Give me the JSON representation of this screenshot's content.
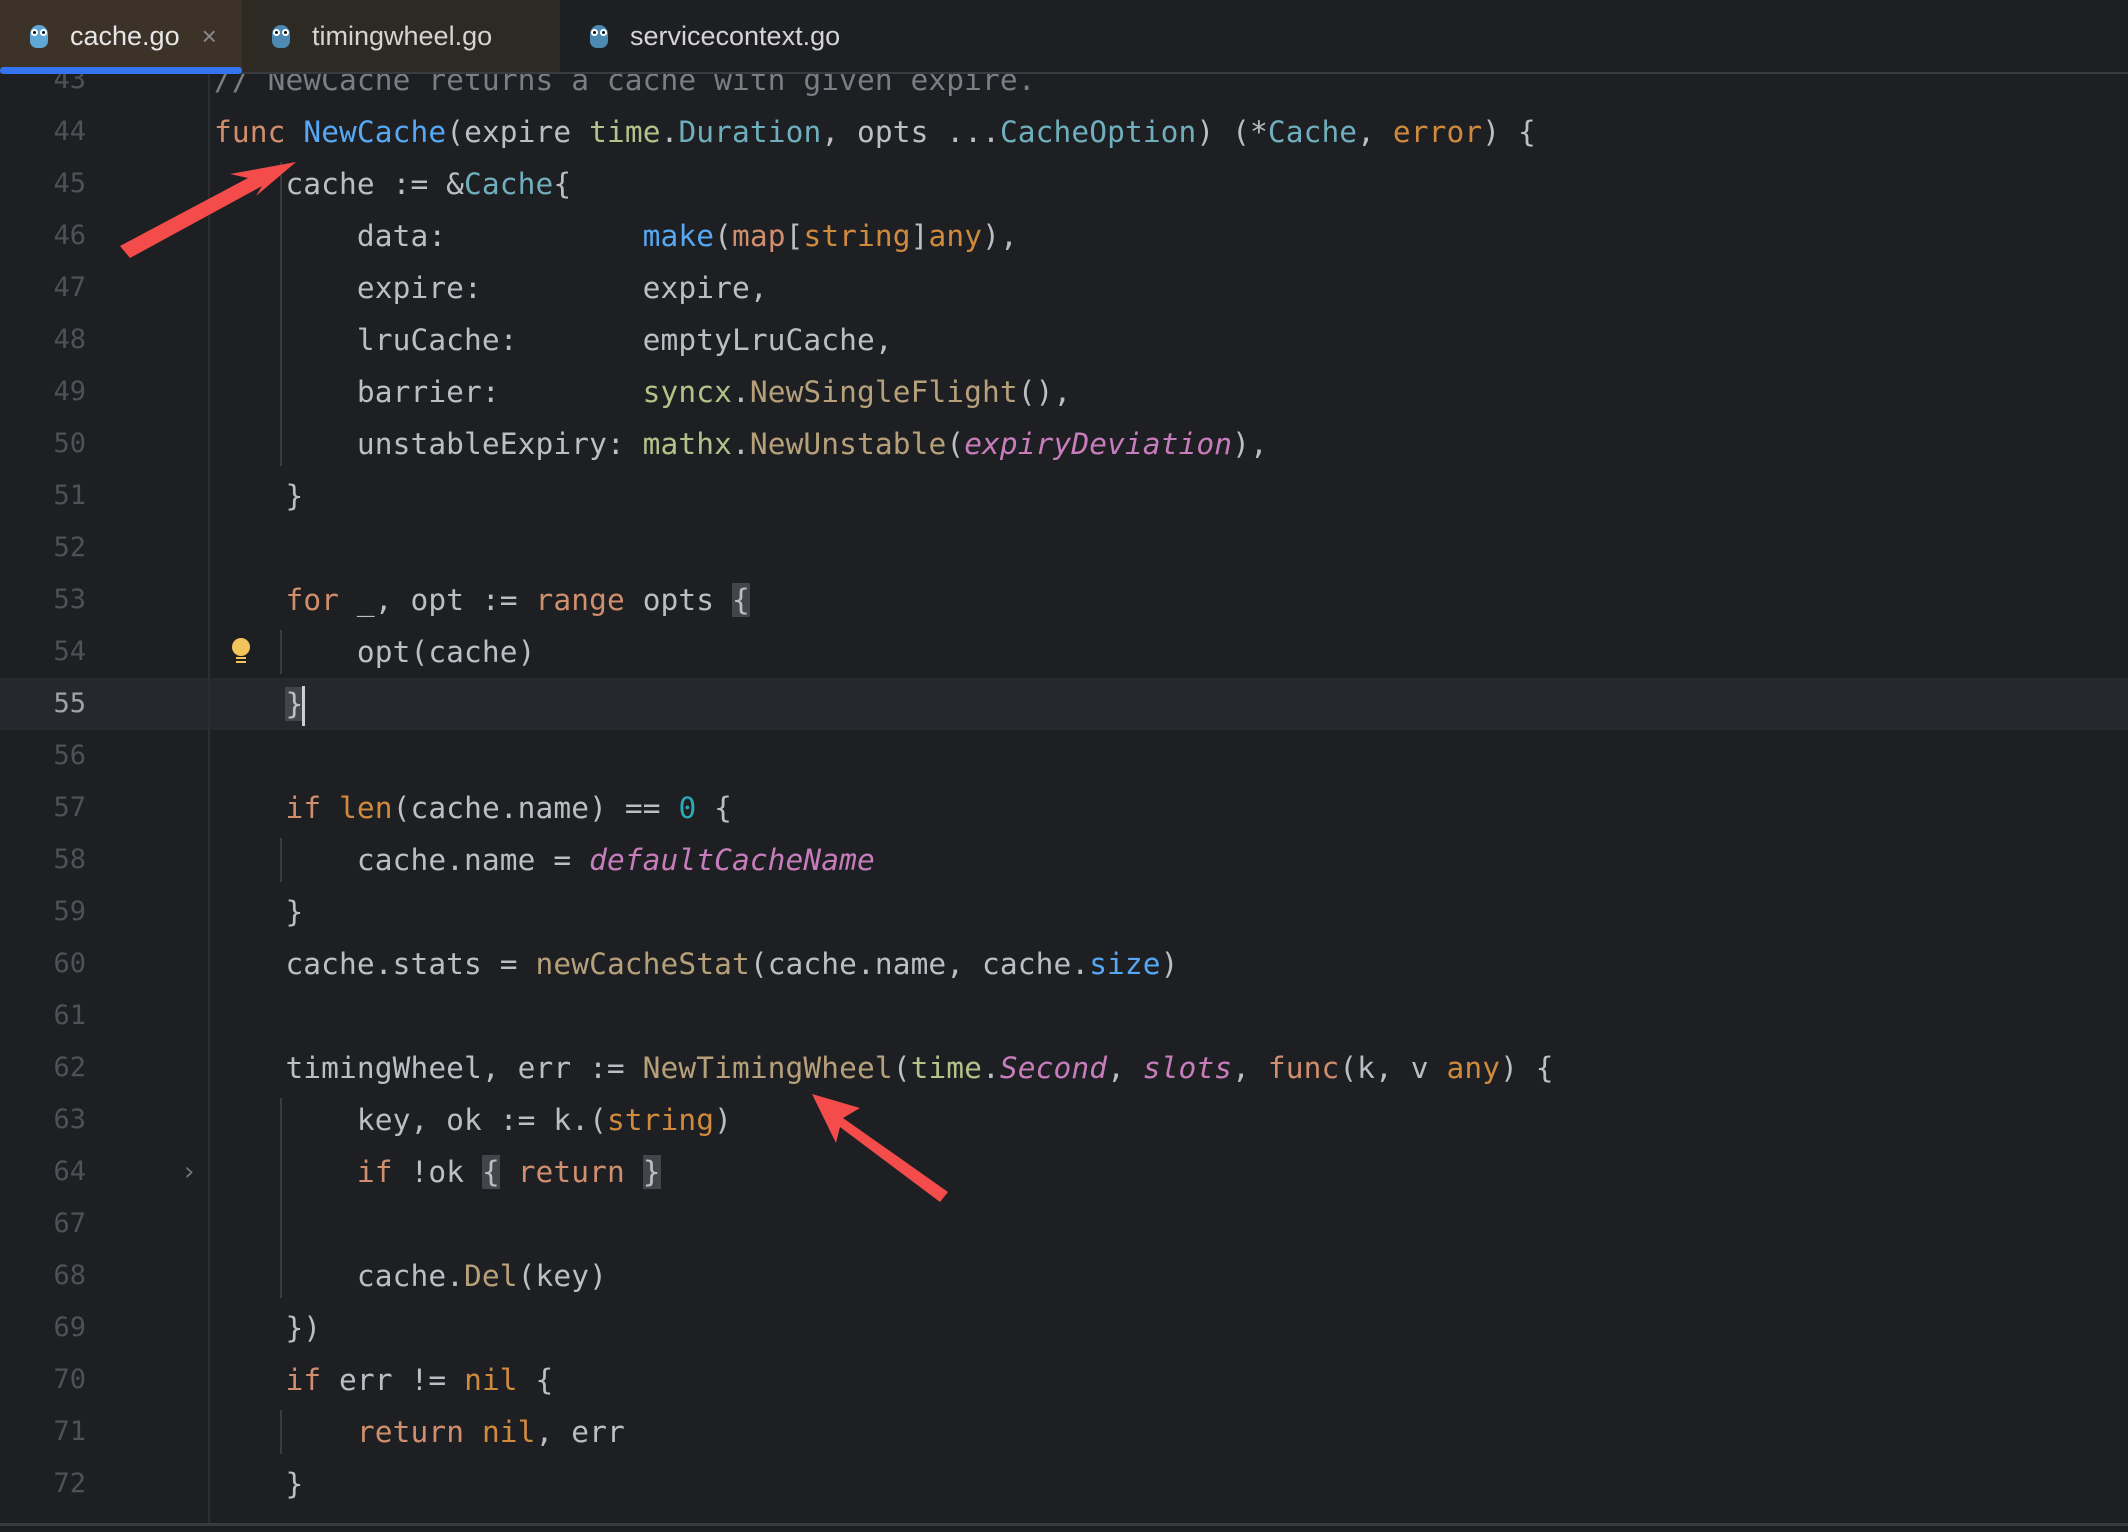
{
  "tabs": [
    {
      "label": "cache.go",
      "icon": "gopher-icon",
      "active": true,
      "close": "×"
    },
    {
      "label": "timingwheel.go",
      "icon": "gopher-icon",
      "active": false
    },
    {
      "label": "servicecontext.go",
      "icon": "gopher-icon",
      "active": false
    }
  ],
  "editor": {
    "current_line": "55",
    "lines": [
      {
        "n": "43",
        "tokens": [
          [
            "// NewCache returns a cache with given expire.",
            "cm"
          ]
        ]
      },
      {
        "n": "44",
        "tokens": [
          [
            "func",
            "kw"
          ],
          [
            " "
          ],
          [
            "NewCache",
            "fn"
          ],
          [
            "(expire "
          ],
          [
            "time",
            "pkg"
          ],
          [
            "."
          ],
          [
            "Duration",
            "ty"
          ],
          [
            ", opts ..."
          ],
          [
            "CacheOption",
            "ty"
          ],
          [
            ") (*"
          ],
          [
            "Cache",
            "ty"
          ],
          [
            ", "
          ],
          [
            "error",
            "bt"
          ],
          [
            ") {"
          ]
        ]
      },
      {
        "n": "45",
        "tokens": [
          [
            "    cache := &"
          ],
          [
            "Cache",
            "ty"
          ],
          [
            "{"
          ]
        ]
      },
      {
        "n": "46",
        "tokens": [
          [
            "        data:           "
          ],
          [
            "make",
            "fn"
          ],
          [
            "("
          ],
          [
            "map",
            "kw"
          ],
          [
            "["
          ],
          [
            "string",
            "bt"
          ],
          [
            "]"
          ],
          [
            "any",
            "bt"
          ],
          [
            "),"
          ]
        ]
      },
      {
        "n": "47",
        "tokens": [
          [
            "        expire:         expire,"
          ]
        ]
      },
      {
        "n": "48",
        "tokens": [
          [
            "        lruCache:       emptyLruCache,"
          ]
        ]
      },
      {
        "n": "49",
        "tokens": [
          [
            "        barrier:        "
          ],
          [
            "syncx",
            "pkg"
          ],
          [
            "."
          ],
          [
            "NewSingleFlight",
            "call"
          ],
          [
            "(),"
          ]
        ]
      },
      {
        "n": "50",
        "tokens": [
          [
            "        unstableExpiry: "
          ],
          [
            "mathx",
            "pkg"
          ],
          [
            "."
          ],
          [
            "NewUnstable",
            "call"
          ],
          [
            "("
          ],
          [
            "expiryDeviation",
            "cst"
          ],
          [
            "),"
          ]
        ]
      },
      {
        "n": "51",
        "tokens": [
          [
            "    }"
          ]
        ]
      },
      {
        "n": "52",
        "tokens": []
      },
      {
        "n": "53",
        "tokens": [
          [
            "    "
          ],
          [
            "for",
            "kw"
          ],
          [
            " _, opt := "
          ],
          [
            "range",
            "kw"
          ],
          [
            " opts "
          ],
          [
            "{",
            "brace-hl"
          ]
        ]
      },
      {
        "n": "54",
        "tokens": [
          [
            "        opt(cache)"
          ]
        ],
        "bulb": true
      },
      {
        "n": "55",
        "tokens": [
          [
            "    "
          ],
          [
            "}",
            "brace-hl"
          ],
          [
            "",
            "caret"
          ]
        ]
      },
      {
        "n": "56",
        "tokens": []
      },
      {
        "n": "57",
        "tokens": [
          [
            "    "
          ],
          [
            "if",
            "kw"
          ],
          [
            " "
          ],
          [
            "len",
            "bt"
          ],
          [
            "(cache.name) == "
          ],
          [
            "0",
            "num"
          ],
          [
            " {"
          ]
        ]
      },
      {
        "n": "58",
        "tokens": [
          [
            "        cache.name = "
          ],
          [
            "defaultCacheName",
            "cst"
          ]
        ]
      },
      {
        "n": "59",
        "tokens": [
          [
            "    }"
          ]
        ]
      },
      {
        "n": "60",
        "tokens": [
          [
            "    cache.stats = "
          ],
          [
            "newCacheStat",
            "call"
          ],
          [
            "(cache.name, cache."
          ],
          [
            "size",
            "fn"
          ],
          [
            ")"
          ]
        ]
      },
      {
        "n": "61",
        "tokens": []
      },
      {
        "n": "62",
        "tokens": [
          [
            "    timingWheel, err := "
          ],
          [
            "NewTimingWheel",
            "call"
          ],
          [
            "("
          ],
          [
            "time",
            "pkg"
          ],
          [
            "."
          ],
          [
            "Second",
            "cst"
          ],
          [
            ", "
          ],
          [
            "slots",
            "cst"
          ],
          [
            ", "
          ],
          [
            "func",
            "kw"
          ],
          [
            "(k, v "
          ],
          [
            "any",
            "bt"
          ],
          [
            ") {"
          ]
        ]
      },
      {
        "n": "63",
        "tokens": [
          [
            "        key, ok := k.("
          ],
          [
            "string",
            "bt"
          ],
          [
            ")"
          ]
        ]
      },
      {
        "n": "64",
        "tokens": [
          [
            "        "
          ],
          [
            "if",
            "kw"
          ],
          [
            " !ok "
          ],
          [
            "{",
            "brace-hl"
          ],
          [
            " "
          ],
          [
            "return",
            "kw"
          ],
          [
            " "
          ],
          [
            "}",
            "brace-hl"
          ]
        ],
        "fold": "›"
      },
      {
        "n": "67",
        "tokens": []
      },
      {
        "n": "68",
        "tokens": [
          [
            "        cache."
          ],
          [
            "Del",
            "call"
          ],
          [
            "(key)"
          ]
        ]
      },
      {
        "n": "69",
        "tokens": [
          [
            "    })"
          ]
        ]
      },
      {
        "n": "70",
        "tokens": [
          [
            "    "
          ],
          [
            "if",
            "kw"
          ],
          [
            " err != "
          ],
          [
            "nil",
            "bt"
          ],
          [
            " {"
          ]
        ]
      },
      {
        "n": "71",
        "tokens": [
          [
            "        "
          ],
          [
            "return",
            "kw"
          ],
          [
            " "
          ],
          [
            "nil",
            "bt"
          ],
          [
            ", err"
          ]
        ]
      },
      {
        "n": "72",
        "tokens": [
          [
            "    }"
          ]
        ]
      }
    ]
  },
  "annotations": [
    {
      "name": "arrow-to-newcache",
      "color": "#F44B4B"
    },
    {
      "name": "arrow-to-newtimingwheel",
      "color": "#F44B4B"
    }
  ],
  "colors": {
    "background": "#1E1F22",
    "accent": "#3574F0",
    "keyword": "#CF8E6D",
    "function": "#56A8F5",
    "constant": "#C77DBB"
  }
}
